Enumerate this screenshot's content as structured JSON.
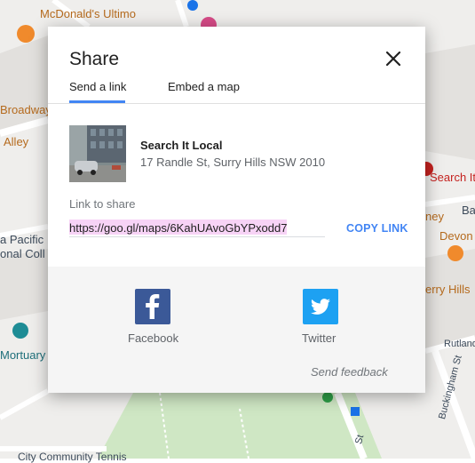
{
  "map": {
    "labels": {
      "mcdonalds": "McDonald's Ultimo",
      "broadway": "Broadway",
      "alley": "Alley",
      "pacific": "a Pacific",
      "onal_coll": "onal Coll",
      "mortuary": "Mortuary",
      "search_it": "Search It",
      "ney": "ney",
      "ba": "Ba",
      "devon": "Devon",
      "erry_hills": "erry Hills",
      "rutland": "Rutland",
      "buckingham": "Buckingham St",
      "st": "St",
      "city_tennis": "City Community Tennis"
    }
  },
  "dialog": {
    "title": "Share",
    "close_icon": "close-icon",
    "tabs": [
      {
        "label": "Send a link",
        "active": true
      },
      {
        "label": "Embed a map",
        "active": false
      }
    ],
    "place": {
      "name": "Search It Local",
      "address": "17 Randle St, Surry Hills NSW 2010"
    },
    "link": {
      "label": "Link to share",
      "value": "https://goo.gl/maps/6KahUAvoGbYPxodd7",
      "copy_label": "COPY LINK"
    },
    "social": [
      {
        "name": "Facebook",
        "icon": "facebook-icon",
        "color": "#3b5998"
      },
      {
        "name": "Twitter",
        "icon": "twitter-icon",
        "color": "#1da1f2"
      }
    ],
    "feedback": "Send feedback"
  },
  "colors": {
    "accent": "#4285f4",
    "selection": "#f7d3f6"
  }
}
